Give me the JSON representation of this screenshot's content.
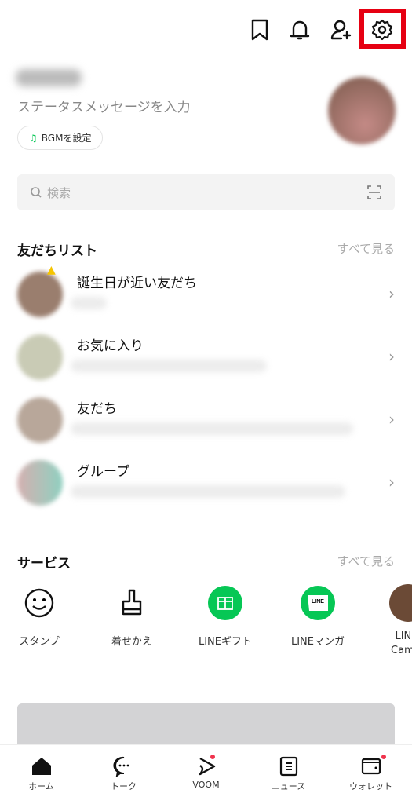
{
  "header": {
    "icons": [
      "bookmark-icon",
      "bell-icon",
      "add-friend-icon",
      "settings-icon"
    ],
    "highlight_color": "#e60012"
  },
  "profile": {
    "status_placeholder": "ステータスメッセージを入力",
    "bgm_label": "BGMを設定"
  },
  "search": {
    "placeholder": "検索"
  },
  "friends": {
    "title": "友だちリスト",
    "see_all": "すべて見る",
    "rows": [
      {
        "label": "誕生日が近い友だち"
      },
      {
        "label": "お気に入り"
      },
      {
        "label": "友だち"
      },
      {
        "label": "グループ"
      }
    ]
  },
  "services": {
    "title": "サービス",
    "see_all": "すべて見る",
    "items": [
      {
        "label": "スタンプ"
      },
      {
        "label": "着せかえ"
      },
      {
        "label": "LINEギフト"
      },
      {
        "label": "LINEマンガ"
      },
      {
        "label": "LINE Camera"
      }
    ],
    "accent": "#06c755"
  },
  "nav": {
    "items": [
      {
        "label": "ホーム"
      },
      {
        "label": "トーク"
      },
      {
        "label": "VOOM"
      },
      {
        "label": "ニュース"
      },
      {
        "label": "ウォレット"
      }
    ],
    "badge_color": "#f0334d"
  }
}
